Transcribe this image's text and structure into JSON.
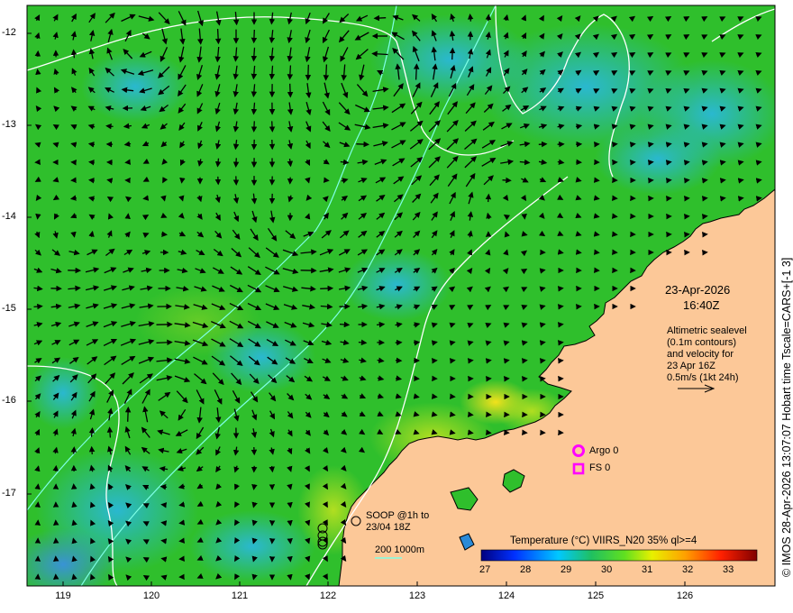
{
  "map": {
    "lat_ticks": [
      "-12",
      "-13",
      "-14",
      "-15",
      "-16",
      "-17"
    ],
    "lon_ticks": [
      "119",
      "120",
      "121",
      "122",
      "123",
      "124",
      "125",
      "126"
    ],
    "side_label": "© IMOS 28-Apr-2026 13:07:07 Hobart time Tscale=CARS+[-1 3]",
    "timestamp_date": "23-Apr-2026",
    "timestamp_time": "16:40Z",
    "description_lines": [
      "Altimetric sealevel",
      "(0.1m contours)",
      "and velocity for",
      "23 Apr 16Z",
      "0.5m/s (1kt 24h)"
    ],
    "argo_label": "Argo 0",
    "fs_label": "FS 0",
    "soop_label_lines": [
      "SOOP @1h to",
      "23/04 18Z"
    ],
    "depth_label": "200  1000m",
    "colorbar_title": "Temperature (°C) VIIRS_N20 35% ql>=4",
    "colorbar_ticks": [
      "27",
      "28",
      "29",
      "30",
      "31",
      "32",
      "33"
    ],
    "colors": {
      "land": "#fcc898",
      "ocean": "#2fbf2c",
      "contour": "#ffffff",
      "bathymetry": "#7fffe6",
      "argo": "#ff00ff"
    }
  }
}
